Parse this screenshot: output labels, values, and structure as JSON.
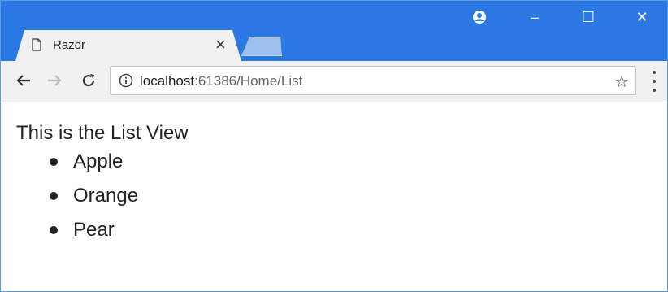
{
  "browser": {
    "tab": {
      "title": "Razor",
      "close_glyph": "×",
      "icon": "page-icon"
    },
    "window_controls": {
      "profile_icon": "profile-icon",
      "minimize_glyph": "–",
      "maximize_glyph": "☐",
      "close_glyph": "✕"
    },
    "toolbar": {
      "back_glyph": "←",
      "forward_glyph": "→",
      "reload_glyph": "C",
      "url_host": "localhost",
      "url_rest": ":61386/Home/List",
      "star_glyph": "☆",
      "menu_icon": "more-vertical-icon"
    },
    "colors": {
      "titlebar": "#2b78e4",
      "toolbar": "#f1f1f1",
      "text": "#222222"
    }
  },
  "page": {
    "heading": "This is the List View",
    "items": [
      "Apple",
      "Orange",
      "Pear"
    ]
  }
}
